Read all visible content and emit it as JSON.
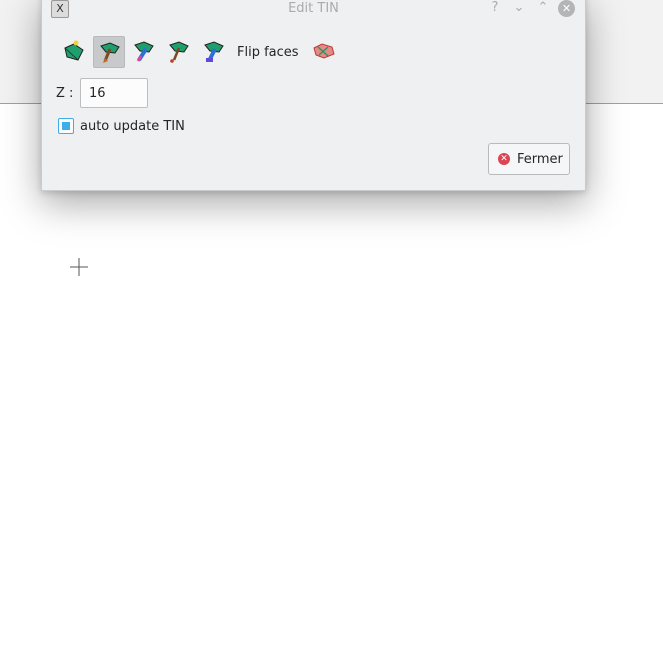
{
  "window": {
    "title": "Edit TIN",
    "app_icon": "app-icon",
    "controls": {
      "help": "?",
      "minimize": "⌄",
      "maximize": "⌃",
      "close": "✕"
    }
  },
  "toolbar": {
    "tools": [
      {
        "name": "add-vertex-icon",
        "active": false
      },
      {
        "name": "move-vertex-icon",
        "active": true
      },
      {
        "name": "edit-vertex-icon",
        "active": false
      },
      {
        "name": "delete-vertex-icon",
        "active": false
      },
      {
        "name": "pick-vertex-icon",
        "active": false
      }
    ],
    "flip_label": "Flip faces",
    "last_tool": "remove-faces-icon"
  },
  "z": {
    "label": "Z :",
    "value": "16"
  },
  "auto_update": {
    "label": "auto update TIN",
    "checked": true
  },
  "close_button": {
    "label": "Fermer",
    "icon": "close-circle-icon"
  },
  "colors": {
    "accent": "#3daee9",
    "danger": "#da4453",
    "dialog_bg": "#eff0f1"
  }
}
